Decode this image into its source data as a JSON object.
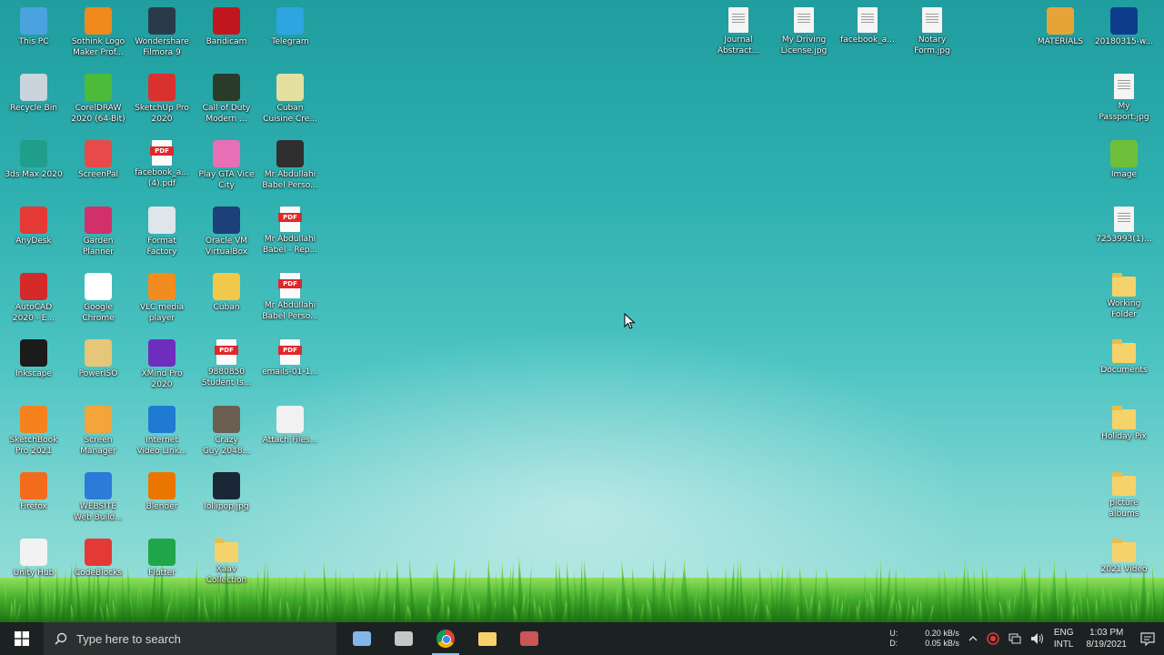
{
  "desktop": {
    "left_icons": [
      {
        "label": "This PC",
        "color": "#4aa3df",
        "icon": "pc-icon",
        "kind": "app"
      },
      {
        "label": "Sothink Logo\nMaker Prof...",
        "color": "#f08a1c",
        "icon": "logo-maker-icon",
        "kind": "app"
      },
      {
        "label": "Wondershare\nFilmora 9",
        "color": "#2b3a4a",
        "icon": "filmora-icon",
        "kind": "app"
      },
      {
        "label": "Bandicam",
        "color": "#c0171f",
        "icon": "bandicam-icon",
        "kind": "app"
      },
      {
        "label": "Telegram",
        "color": "#2ca5e0",
        "icon": "telegram-icon",
        "kind": "app"
      },
      {
        "label": "Recycle Bin",
        "color": "#c9d4dc",
        "icon": "recycle-bin-icon",
        "kind": "app"
      },
      {
        "label": "CorelDRAW\n2020 (64-Bit)",
        "color": "#4cbb3a",
        "icon": "coreldraw-icon",
        "kind": "app"
      },
      {
        "label": "SketchUp Pro\n2020",
        "color": "#d93030",
        "icon": "sketchup-icon",
        "kind": "app"
      },
      {
        "label": "Call of Duty\nModern ...",
        "color": "#2a3b2a",
        "icon": "game-icon",
        "kind": "app"
      },
      {
        "label": "Cuban\nCuisine Cre...",
        "color": "#e4e1a0",
        "icon": "document-icon",
        "kind": "app"
      },
      {
        "label": "3ds Max 2020",
        "color": "#1f9e8c",
        "icon": "3dsmax-icon",
        "kind": "app"
      },
      {
        "label": "ScreenPal",
        "color": "#e84a4a",
        "icon": "screen-recorder-icon",
        "kind": "app"
      },
      {
        "label": "facebook_a...\n(4).pdf",
        "color": "#e0272b",
        "icon": "pdf-icon",
        "kind": "pdf"
      },
      {
        "label": "Play GTA Vice\nCity",
        "color": "#e86fb5",
        "icon": "game-icon",
        "kind": "app"
      },
      {
        "label": "Mr Abdullahi\nBabel Perso...",
        "color": "#2f2f2f",
        "icon": "document-icon",
        "kind": "app"
      },
      {
        "label": "AnyDesk",
        "color": "#e53935",
        "icon": "anydesk-icon",
        "kind": "app"
      },
      {
        "label": "Garden\nPlanner",
        "color": "#d1306b",
        "icon": "planner-icon",
        "kind": "app"
      },
      {
        "label": "Format\nFactory",
        "color": "#dfe5ea",
        "icon": "format-factory-icon",
        "kind": "app"
      },
      {
        "label": "Oracle VM\nVirtualBox",
        "color": "#1d3f7a",
        "icon": "virtualbox-icon",
        "kind": "app"
      },
      {
        "label": "Mr Abdullahi\nBabel - Rep...",
        "color": "#e0272b",
        "icon": "pdf-icon",
        "kind": "pdf"
      },
      {
        "label": "AutoCAD\n2020 - E...",
        "color": "#d42a2a",
        "icon": "autocad-icon",
        "kind": "app"
      },
      {
        "label": "Google\nChrome",
        "color": "#ffffff",
        "icon": "chrome-icon",
        "kind": "app"
      },
      {
        "label": "VLC media\nplayer",
        "color": "#f28c1f",
        "icon": "vlc-icon",
        "kind": "app"
      },
      {
        "label": "Cuban",
        "color": "#f1c84a",
        "icon": "document-icon",
        "kind": "app"
      },
      {
        "label": "Mr Abdullahi\nBabel Perso...",
        "color": "#e0272b",
        "icon": "pdf-icon",
        "kind": "pdf"
      },
      {
        "label": "Inkscape",
        "color": "#1b1b1b",
        "icon": "inkscape-icon",
        "kind": "app"
      },
      {
        "label": "PowerISO",
        "color": "#e6c77a",
        "icon": "poweriso-icon",
        "kind": "app"
      },
      {
        "label": "XMind Pro\n2020",
        "color": "#6f2dbd",
        "icon": "mind-map-icon",
        "kind": "app"
      },
      {
        "label": "9880850\nStudent Is...",
        "color": "#e0272b",
        "icon": "pdf-icon",
        "kind": "pdf"
      },
      {
        "label": "emails-01-1...",
        "color": "#e0272b",
        "icon": "pdf-icon",
        "kind": "pdf"
      },
      {
        "label": "SketchBook\nPro 2021",
        "color": "#f5821f",
        "icon": "sketchbook-icon",
        "kind": "app"
      },
      {
        "label": "Screen\nManager",
        "color": "#f3a43b",
        "icon": "chat-icon",
        "kind": "app"
      },
      {
        "label": "Internet\nVideo Link...",
        "color": "#1f7bd1",
        "icon": "download-icon",
        "kind": "app"
      },
      {
        "label": "Crazy\nGuy 2048...",
        "color": "#6b5f52",
        "icon": "game-icon",
        "kind": "app"
      },
      {
        "label": "Attach Files...",
        "color": "#f1f1f1",
        "icon": "document-icon",
        "kind": "app"
      },
      {
        "label": "Firefox",
        "color": "#f36b1c",
        "icon": "firefox-icon",
        "kind": "app"
      },
      {
        "label": "WEBSITE\nWeb Build...",
        "color": "#2d7bd8",
        "icon": "web-builder-icon",
        "kind": "app"
      },
      {
        "label": "Blender",
        "color": "#ea7600",
        "icon": "blender-icon",
        "kind": "app"
      },
      {
        "label": "lollipop.jpg",
        "color": "#1b2736",
        "icon": "image-icon",
        "kind": "app"
      },
      {
        "label": "",
        "color": "#000000",
        "icon": "",
        "kind": "none"
      },
      {
        "label": "Unity Hub",
        "color": "#f2f2f2",
        "icon": "unity-icon",
        "kind": "app"
      },
      {
        "label": "CodeBlocks",
        "color": "#e53935",
        "icon": "codeblocks-icon",
        "kind": "app"
      },
      {
        "label": "Flutter",
        "color": "#1fa64b",
        "icon": "grid-app-icon",
        "kind": "app"
      },
      {
        "label": "Xaav\nCollection",
        "color": "#f6d36a",
        "icon": "folder-icon",
        "kind": "folder"
      }
    ],
    "top_icons": [
      {
        "label": "Journal\nAbstract...",
        "kind": "doc",
        "icon": "document-icon"
      },
      {
        "label": "My Driving\nLicense.jpg",
        "kind": "doc",
        "icon": "image-file-icon"
      },
      {
        "label": "facebook_a...",
        "kind": "doc",
        "icon": "document-icon"
      },
      {
        "label": "Notary\nForm.jpg",
        "kind": "doc",
        "icon": "image-file-icon"
      },
      {
        "label": "MATERIALS",
        "kind": "app",
        "color": "#e7a436",
        "icon": "archive-icon"
      },
      {
        "label": "20180315-w...",
        "kind": "app",
        "color": "#0d3c8c",
        "icon": "video-file-icon"
      }
    ],
    "right_icons": [
      {
        "label": "My\nPassport.jpg",
        "kind": "doc",
        "icon": "image-file-icon"
      },
      {
        "label": "Image",
        "kind": "app",
        "color": "#6fbf3b",
        "icon": "image-icon"
      },
      {
        "label": "7253993(1)...",
        "kind": "doc",
        "icon": "document-icon"
      },
      {
        "label": "Working\nFolder",
        "kind": "folder",
        "icon": "folder-icon"
      },
      {
        "label": "Documents",
        "kind": "folder",
        "icon": "folder-icon"
      },
      {
        "label": "Holiday Pix",
        "kind": "folder",
        "icon": "folder-icon"
      },
      {
        "label": "picture\nalbums",
        "kind": "folder",
        "icon": "folder-icon"
      },
      {
        "label": "2021 Video",
        "kind": "folder",
        "icon": "folder-icon"
      }
    ]
  },
  "taskbar": {
    "search_placeholder": "Type here to search",
    "apps": [
      {
        "name": "task-view",
        "icon": "task-view-icon",
        "color": "#8fc8ff"
      },
      {
        "name": "paint",
        "icon": "paint-icon",
        "color": "#d9d9d9"
      },
      {
        "name": "chrome",
        "icon": "chrome-icon",
        "color": "#ffffff",
        "active": true
      },
      {
        "name": "file-explorer",
        "icon": "folder-icon",
        "color": "#f6d36a"
      },
      {
        "name": "snipping",
        "icon": "snipping-icon",
        "color": "#e05b5b"
      }
    ],
    "tray": {
      "network_up_label": "U:",
      "network_down_label": "D:",
      "network_up": "0.20 kB/s",
      "network_down": "0.05 kB/s",
      "language_top": "ENG",
      "language_bottom": "INTL",
      "time": "1:03 PM",
      "date": "8/19/2021"
    }
  }
}
